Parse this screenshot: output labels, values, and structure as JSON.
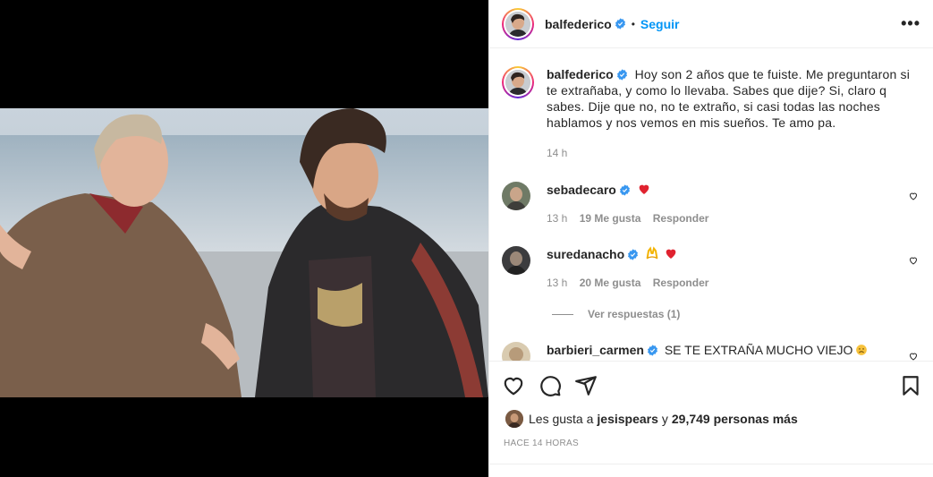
{
  "post": {
    "author": "balfederico",
    "follow_label": "Seguir",
    "separator": "•",
    "more_label": "•••"
  },
  "caption": {
    "username": "balfederico",
    "text": "Hoy son 2 años que te fuiste. Me preguntaron si te extrañaba, y como lo llevaba. Sabes que dije? Si, claro q sabes. Dije que no, no te extraño, si casi todas las noches hablamos y nos vemos en mis sueños. Te amo pa.",
    "time": "14 h"
  },
  "comments": [
    {
      "username": "sebadecaro",
      "text": "",
      "emojis": [
        "heart"
      ],
      "time": "13 h",
      "likes": "19 Me gusta",
      "reply": "Responder"
    },
    {
      "username": "suredanacho",
      "text": "",
      "emojis": [
        "raised-hands",
        "heart"
      ],
      "time": "13 h",
      "likes": "20 Me gusta",
      "reply": "Responder",
      "view_replies": "Ver respuestas (1)"
    },
    {
      "username": "barbieri_carmen",
      "text": "SE TE EXTRAÑA MUCHO VIEJO",
      "emojis": [
        "sad-face"
      ]
    }
  ],
  "likes": {
    "prefix": "Les gusta a",
    "user": "jesispears",
    "conj": "y",
    "count": "29,749 personas más"
  },
  "timestamp": "HACE 14 HORAS",
  "icons": [
    "heart-icon",
    "comment-icon",
    "share-icon",
    "save-icon",
    "verified-icon",
    "more-icon"
  ],
  "colors": {
    "link": "#0095f6",
    "verified": "#3897f0",
    "heart": "#ed4956",
    "muted": "#8e8e8e"
  }
}
